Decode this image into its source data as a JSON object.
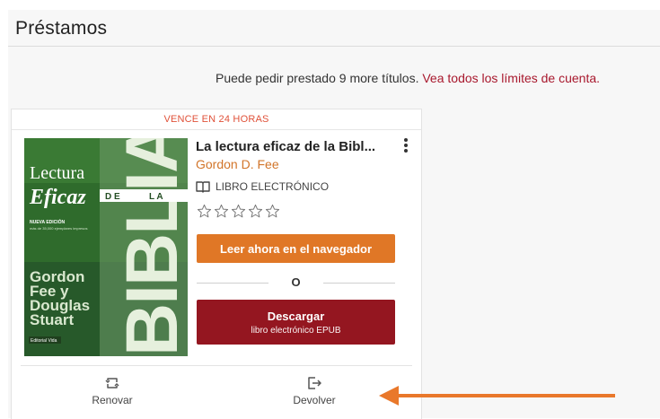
{
  "page": {
    "title": "Préstamos",
    "limit_text": "Puede pedir prestado 9 more títulos. ",
    "limit_link": "Vea todos los límites de cuenta."
  },
  "loan": {
    "due_badge": "VENCE EN 24 HORAS",
    "cover": {
      "word_lectura": "Lectura",
      "word_eficaz": "Eficaz",
      "word_de": "D E",
      "word_la": "L A",
      "word_biblia": "BIBLIA",
      "edition": "NUEVA EDICIÓN",
      "edition_sub": "más de 35,000 ejemplares impresos",
      "authors_line1": "Gordon",
      "authors_line2": "Fee y",
      "authors_line3": "Douglas",
      "authors_line4": "Stuart",
      "publisher": "Editorial Vida"
    },
    "title": "La lectura eficaz de la Bibl...",
    "author": "Gordon D. Fee",
    "format": "LIBRO ELECTRÓNICO",
    "rating_stars": 0,
    "rating_max": 5,
    "read_button": "Leer ahora en el navegador",
    "or_text": "O",
    "download_button": "Descargar",
    "download_sub": "libro electrónico EPUB",
    "renew_label": "Renovar",
    "return_label": "Devolver"
  },
  "colors": {
    "accent_orange": "#e07726",
    "brand_red": "#941620",
    "link_red": "#a8182d",
    "due_text": "#e0523a",
    "annotation_arrow": "#e9782b"
  }
}
